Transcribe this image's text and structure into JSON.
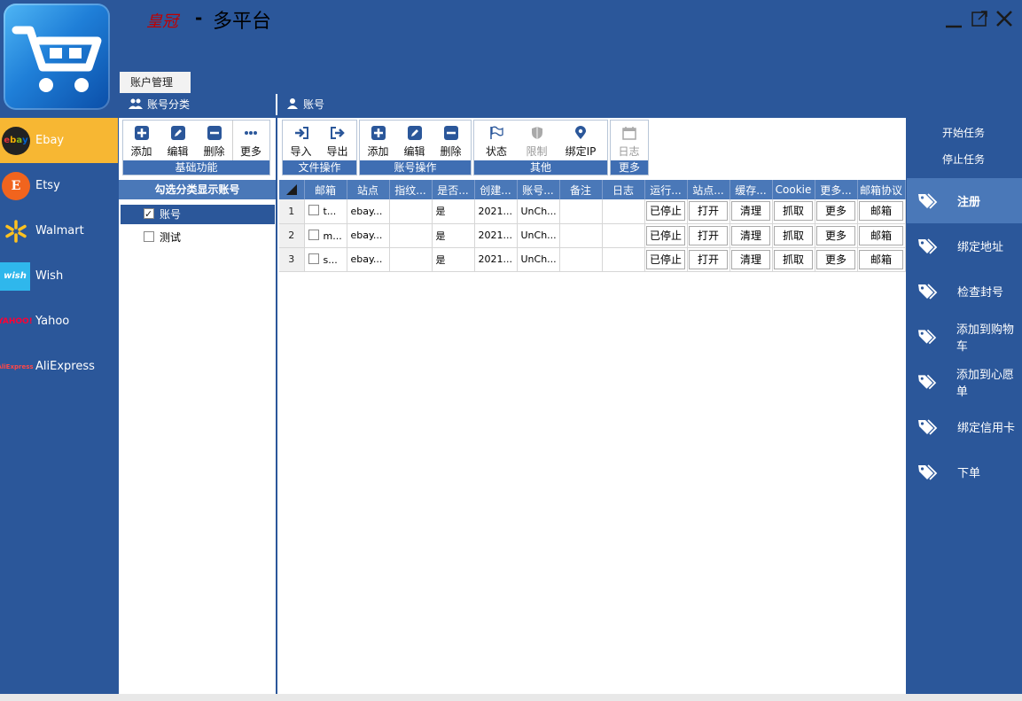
{
  "window": {
    "brand": "皇冠",
    "separator": "-",
    "title": "多平台",
    "controls": [
      "minimize",
      "restore",
      "close"
    ]
  },
  "tab": {
    "label": "账户管理"
  },
  "subheaders": {
    "category": "账号分类",
    "account": "账号"
  },
  "platforms": [
    {
      "name": "Ebay",
      "active": true
    },
    {
      "name": "Etsy"
    },
    {
      "name": "Walmart"
    },
    {
      "name": "Wish"
    },
    {
      "name": "Yahoo"
    },
    {
      "name": "AliExpress"
    }
  ],
  "category_toolbar": {
    "buttons": [
      "添加",
      "编辑",
      "删除",
      "更多"
    ],
    "caption": "基础功能"
  },
  "category_panel": {
    "header": "勾选分类显示账号",
    "items": [
      {
        "label": "账号",
        "checked": true,
        "selected": true
      },
      {
        "label": "测试",
        "checked": false
      }
    ]
  },
  "main_toolbar": {
    "file": {
      "buttons": [
        "导入",
        "导出"
      ],
      "caption": "文件操作"
    },
    "account": {
      "buttons": [
        "添加",
        "编辑",
        "删除"
      ],
      "caption": "账号操作"
    },
    "other": {
      "buttons": [
        "状态",
        "限制",
        "绑定IP"
      ],
      "caption": "其他"
    },
    "more": {
      "buttons": [
        "日志"
      ],
      "caption": "更多"
    }
  },
  "grid": {
    "columns": [
      "邮箱",
      "站点",
      "指纹...",
      "是否...",
      "创建...",
      "账号...",
      "备注",
      "日志",
      "运行...",
      "站点...",
      "缓存...",
      "Cookie",
      "更多...",
      "邮箱协议"
    ],
    "rows": [
      {
        "n": "1",
        "email": "t...",
        "site": "ebay...",
        "fp": "",
        "is": "是",
        "created": "2021...",
        "acct": "UnCh...",
        "note": "",
        "log": "",
        "run": "已停止",
        "open": "打开",
        "cache": "清理",
        "cookie": "抓取",
        "more": "更多",
        "mail": "邮箱"
      },
      {
        "n": "2",
        "email": "m...",
        "site": "ebay...",
        "fp": "",
        "is": "是",
        "created": "2021...",
        "acct": "UnCh...",
        "note": "",
        "log": "",
        "run": "已停止",
        "open": "打开",
        "cache": "清理",
        "cookie": "抓取",
        "more": "更多",
        "mail": "邮箱"
      },
      {
        "n": "3",
        "email": "s...",
        "site": "ebay...",
        "fp": "",
        "is": "是",
        "created": "2021...",
        "acct": "UnCh...",
        "note": "",
        "log": "",
        "run": "已停止",
        "open": "打开",
        "cache": "清理",
        "cookie": "抓取",
        "more": "更多",
        "mail": "邮箱"
      }
    ]
  },
  "tasks": {
    "start": "开始任务",
    "stop": "停止任务"
  },
  "actions": [
    {
      "label": "注册",
      "active": true
    },
    {
      "label": "绑定地址"
    },
    {
      "label": "检查封号"
    },
    {
      "label": "添加到购物车"
    },
    {
      "label": "添加到心愿单"
    },
    {
      "label": "绑定信用卡"
    },
    {
      "label": "下单"
    }
  ],
  "colors": {
    "primary": "#2b579a",
    "header": "#4a78b8",
    "active": "#f7b733",
    "white": "#ffffff"
  }
}
